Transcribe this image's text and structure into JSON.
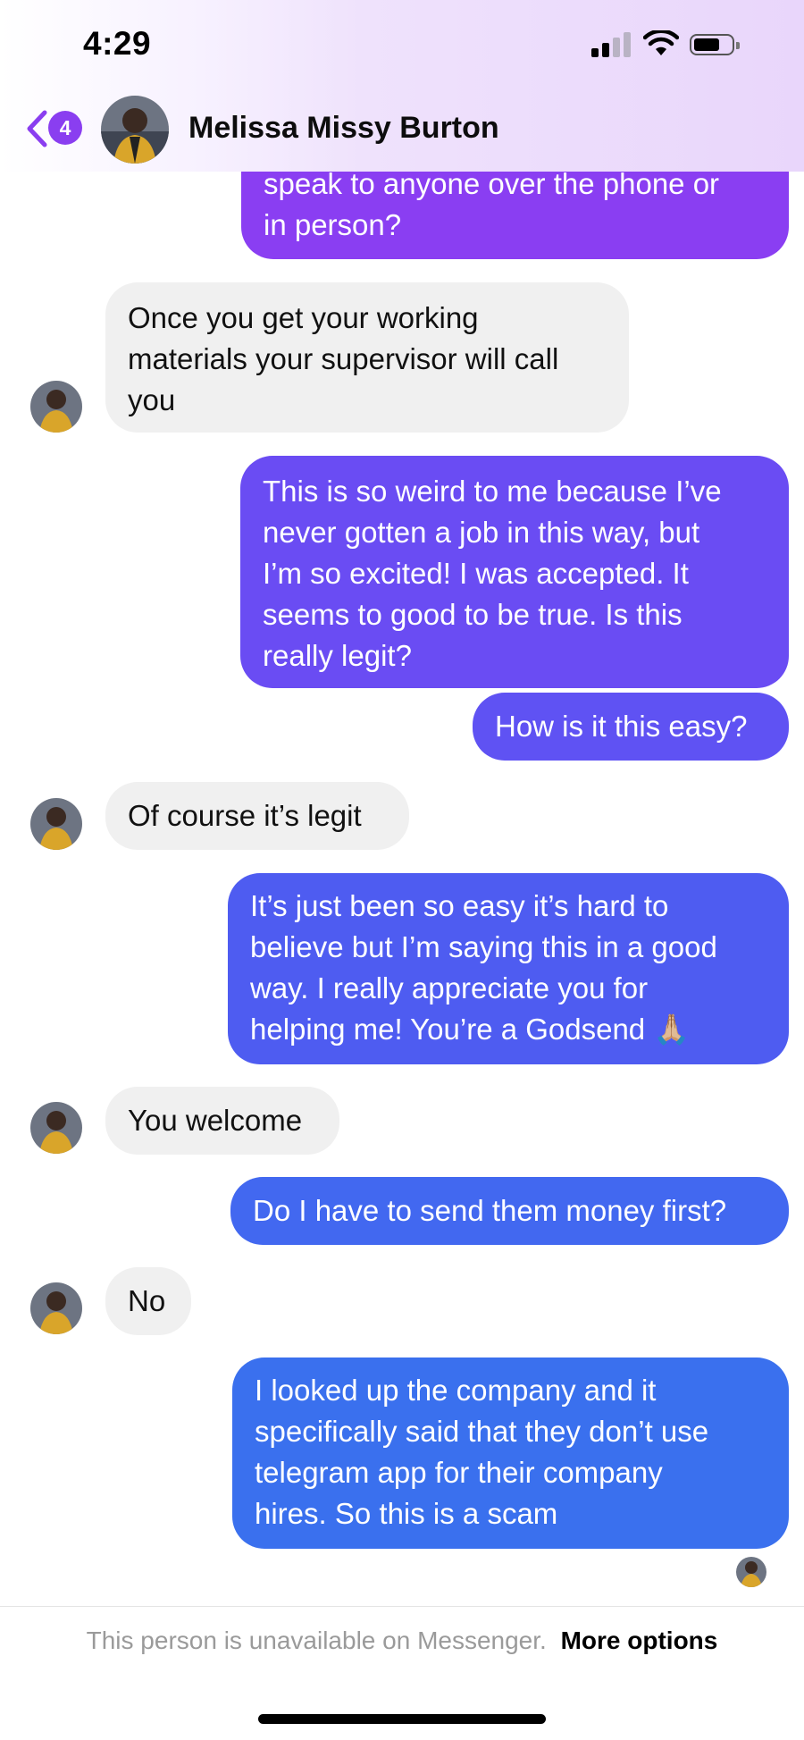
{
  "status_bar": {
    "time": "4:29",
    "icons": [
      "signal-icon",
      "wifi-icon",
      "battery-icon"
    ]
  },
  "header": {
    "back_badge_count": "4",
    "contact_name": "Melissa Missy Burton",
    "back_icon": "chevron-left-icon",
    "accent_color": "#8a3ef0"
  },
  "messages": [
    {
      "direction": "out",
      "lines": [
        "speak to anyone over the phone or",
        "in person?"
      ],
      "color": "#8a3ef2"
    },
    {
      "direction": "in",
      "lines": [
        "Once you get your working",
        "materials your supervisor will call",
        "you"
      ]
    },
    {
      "direction": "out",
      "lines": [
        "This is so weird to me because I’ve",
        "never gotten a job in this way, but",
        "I’m so excited! I was accepted. It",
        "seems to good to be true. Is this",
        "really legit?"
      ],
      "color": "#6a4cf3"
    },
    {
      "direction": "out",
      "lines": [
        "How is it this easy?"
      ],
      "color": "#5f52f3"
    },
    {
      "direction": "in",
      "lines": [
        "Of course it’s legit"
      ]
    },
    {
      "direction": "out",
      "lines": [
        "It’s just been so easy it’s hard to",
        "believe but I’m saying this in a good",
        "way. I really appreciate you for",
        "helping me! You’re a Godsend 🙏🏼"
      ],
      "color": "#4e5cf1"
    },
    {
      "direction": "in",
      "lines": [
        "You welcome"
      ]
    },
    {
      "direction": "out",
      "lines": [
        "Do I have to send them money first?"
      ],
      "color": "#4268f0"
    },
    {
      "direction": "in",
      "lines": [
        "No"
      ]
    },
    {
      "direction": "out",
      "lines": [
        "I looked up the company and it",
        "specifically said that they don’t use",
        "telegram app for their company",
        "hires. So this is a scam"
      ],
      "color": "#3a70ee"
    }
  ],
  "footer": {
    "notice": "This person is unavailable on Messenger.",
    "link": "More options"
  }
}
